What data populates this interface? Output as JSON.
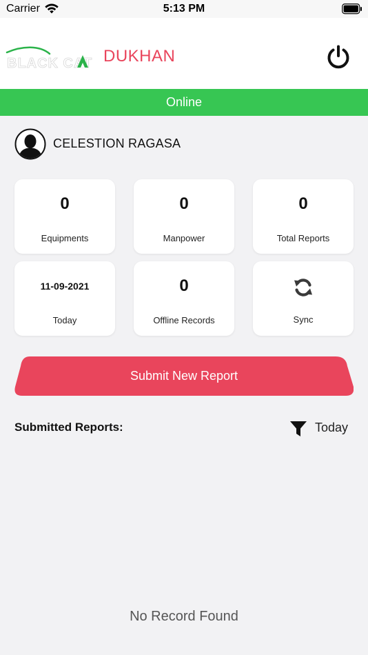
{
  "status_bar": {
    "carrier": "Carrier",
    "time": "5:13 PM",
    "icons": [
      "wifi-icon",
      "battery-icon"
    ]
  },
  "header": {
    "logo_text": "BLACK CAT",
    "title": "DUKHAN",
    "power_icon": "power-icon"
  },
  "connection": {
    "status": "Online"
  },
  "user": {
    "name": "CELESTION RAGASA",
    "avatar_icon": "user-silhouette-icon"
  },
  "stats": [
    {
      "value": "0",
      "label": "Equipments"
    },
    {
      "value": "0",
      "label": "Manpower"
    },
    {
      "value": "0",
      "label": "Total Reports"
    },
    {
      "value": "11-09-2021",
      "label": "Today"
    },
    {
      "value": "0",
      "label": "Offline Records"
    },
    {
      "label": "Sync",
      "icon": "sync-icon"
    }
  ],
  "actions": {
    "submit_label": "Submit New Report"
  },
  "reports": {
    "title": "Submitted Reports:",
    "filter_label": "Today",
    "filter_icon": "filter-icon",
    "empty_text": "No Record Found"
  },
  "colors": {
    "accent": "#e9455c",
    "online": "#37c653",
    "background": "#f2f2f4",
    "card": "#ffffff",
    "logo_green": "#2bb34a"
  }
}
